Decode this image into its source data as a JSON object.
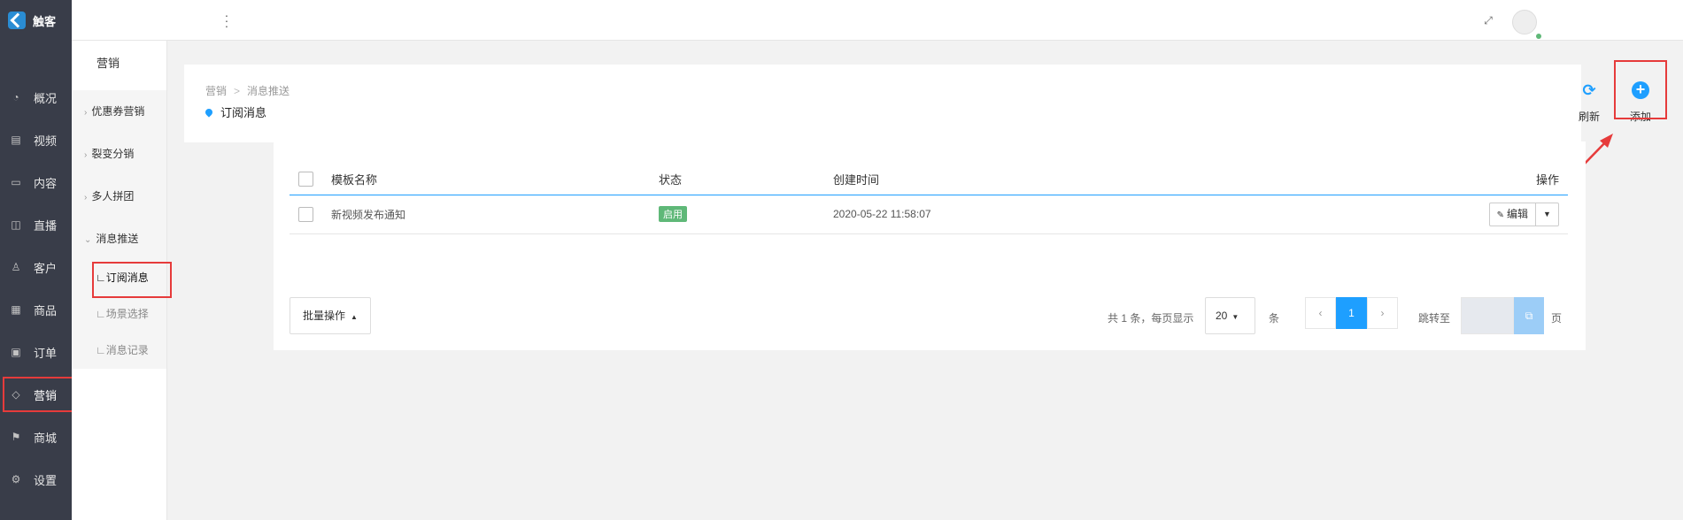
{
  "app": {
    "logo_text": "触客"
  },
  "sidebar": {
    "items": [
      {
        "label": "概况",
        "icon": "gauge-icon",
        "glyph": "◔"
      },
      {
        "label": "视频",
        "icon": "video-icon",
        "glyph": "▤"
      },
      {
        "label": "内容",
        "icon": "monitor-icon",
        "glyph": "▭"
      },
      {
        "label": "直播",
        "icon": "camera-icon",
        "glyph": "◫"
      },
      {
        "label": "客户",
        "icon": "user-icon",
        "glyph": "♙"
      },
      {
        "label": "商品",
        "icon": "grid-icon",
        "glyph": "▦"
      },
      {
        "label": "订单",
        "icon": "calendar-icon",
        "glyph": "▣"
      },
      {
        "label": "营销",
        "icon": "tag-icon",
        "glyph": "◇",
        "active": true
      },
      {
        "label": "商城",
        "icon": "signpost-icon",
        "glyph": "⚑"
      },
      {
        "label": "设置",
        "icon": "gear-icon",
        "glyph": "⚙"
      }
    ]
  },
  "subnav": {
    "heading": "营销",
    "groups": [
      {
        "label": "优惠券营销",
        "chevron": "›"
      },
      {
        "label": "裂变分销",
        "chevron": "›"
      },
      {
        "label": "多人拼团",
        "chevron": "›"
      },
      {
        "label": "消息推送",
        "chevron": "⌄"
      }
    ],
    "leaves": [
      {
        "label": "∟订阅消息",
        "active": true
      },
      {
        "label": "∟场景选择"
      },
      {
        "label": "∟消息记录"
      }
    ]
  },
  "breadcrumb": {
    "parent": "营销",
    "separator": ">",
    "current": "消息推送"
  },
  "page_title": "订阅消息",
  "toolbar": {
    "refresh_label": "刷新",
    "add_label": "添加",
    "refresh_glyph": "⟳",
    "add_glyph": "+"
  },
  "table": {
    "headers": {
      "name": "模板名称",
      "status": "状态",
      "created": "创建时间",
      "actions": "操作"
    },
    "rows": [
      {
        "name": "新视频发布通知",
        "status": "启用",
        "created": "2020-05-22 11:58:07",
        "edit_label": "编辑"
      }
    ]
  },
  "bulk_action": {
    "label": "批量操作"
  },
  "pagination": {
    "total_text": "共 1 条，每页显示",
    "page_size": "20",
    "unit": "条",
    "current_page": "1",
    "prev": "‹",
    "next": "›",
    "jump_label": "跳转至",
    "page_suffix": "页"
  },
  "colors": {
    "accent": "#1e9fff",
    "sidebar_bg": "#393d49",
    "highlight": "#e63b3b",
    "success": "#5fb878"
  }
}
